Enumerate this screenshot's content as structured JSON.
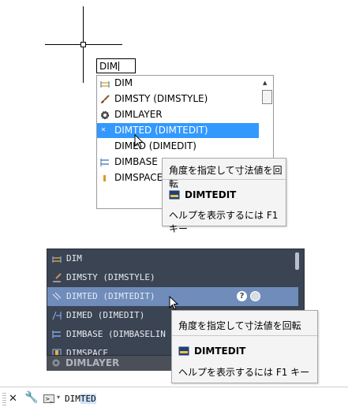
{
  "drawing": {
    "input_value": "DIM"
  },
  "light_list": {
    "items": [
      {
        "label": "DIM",
        "icon": "dimension-icon"
      },
      {
        "label": "DIMSTY (DIMSTYLE)",
        "icon": "brush-icon"
      },
      {
        "label": "DIMLAYER",
        "icon": "gear-icon"
      },
      {
        "label": "DIMTED (DIMTEDIT)",
        "icon": "dimtedit-icon",
        "selected": true
      },
      {
        "label": "DIMED (DIMEDIT)",
        "icon": ""
      },
      {
        "label": "DIMBASE",
        "icon": "baseline-icon"
      },
      {
        "label": "DIMSPACE",
        "icon": "space-icon"
      }
    ]
  },
  "light_tooltip": {
    "description": "角度を指定して寸法値を回転",
    "command": "DIMTEDIT",
    "help": "ヘルプを表示するには F1 キー"
  },
  "dark_list": {
    "items": [
      {
        "label": "DIM"
      },
      {
        "label": "DIMSTY (DIMSTYLE)"
      },
      {
        "label": "DIMTED (DIMTEDIT)",
        "selected": true
      },
      {
        "label": "DIMED (DIMEDIT)"
      },
      {
        "label": "DIMBASE (DIMBASELIN"
      },
      {
        "label": "DIMSPACE"
      }
    ],
    "help_glyph": "?",
    "footer": "DIMLAYER"
  },
  "dark_tooltip": {
    "description": "角度を指定して寸法値を回転",
    "command": "DIMTEDIT",
    "help": "ヘルプを表示するには F1 キー"
  },
  "command_line": {
    "close_glyph": "✕",
    "wrench_glyph": "🔧",
    "prompt_glyph": ">_",
    "chevron_glyph": "▾",
    "typed_prefix": "DIM",
    "typed_highlight": "TED"
  },
  "colors": {
    "select_light": "#3399ff",
    "dark_bg": "#3b4453",
    "select_dark": "#6f8cba"
  }
}
